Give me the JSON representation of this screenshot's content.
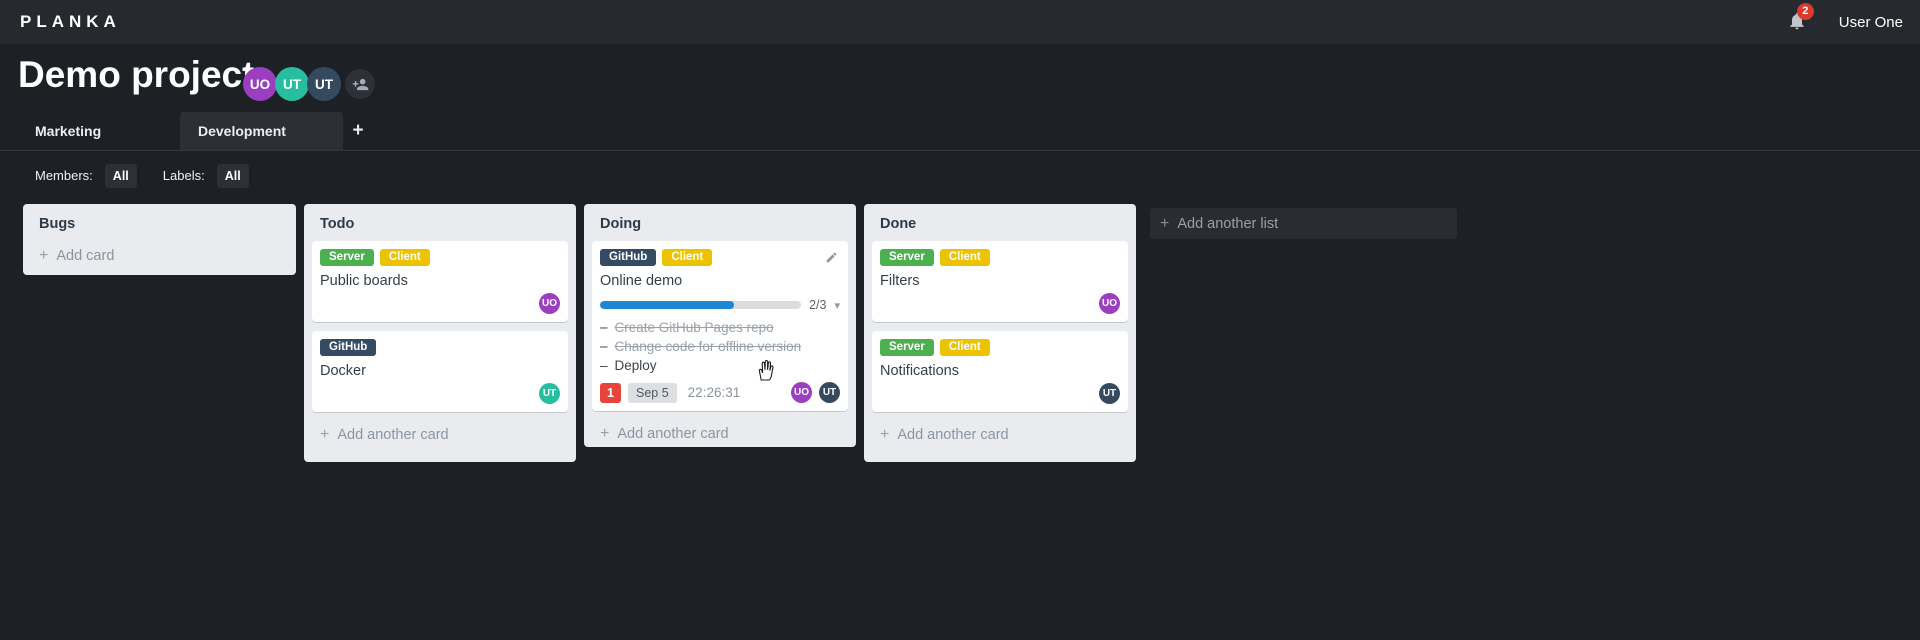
{
  "topbar": {
    "logo": "PLANKA",
    "user_name": "User One",
    "notifications_count": "2"
  },
  "project": {
    "title": "Demo project",
    "members": [
      {
        "initials": "UO",
        "color": "#9b3fc0"
      },
      {
        "initials": "UT",
        "color": "#28bd9e"
      },
      {
        "initials": "UT",
        "color": "#35495f"
      }
    ]
  },
  "tabs": {
    "items": [
      {
        "label": "Marketing"
      },
      {
        "label": "Development"
      }
    ],
    "add": "+"
  },
  "filters": {
    "members_label": "Members:",
    "members_value": "All",
    "labels_label": "Labels:",
    "labels_value": "All"
  },
  "icons": {
    "plus": "+",
    "caret_down": "▾"
  },
  "board": {
    "task_marker": "–",
    "add_list_label": "Add another list",
    "lists": [
      {
        "name": "Bugs",
        "add_label": "Add card",
        "cards": []
      },
      {
        "name": "Todo",
        "add_label": "Add another card",
        "cards": [
          {
            "title": "Public boards",
            "labels": [
              {
                "text": "Server",
                "color": "#4caf50"
              },
              {
                "text": "Client",
                "color": "#edc300"
              }
            ],
            "assignees": [
              {
                "initials": "UO",
                "color": "#9b3fc0"
              }
            ]
          },
          {
            "title": "Docker",
            "labels": [
              {
                "text": "GitHub",
                "color": "#354a63"
              }
            ],
            "assignees": [
              {
                "initials": "UT",
                "color": "#28bd9e"
              }
            ]
          }
        ]
      },
      {
        "name": "Doing",
        "add_label": "Add another card",
        "cards": [
          {
            "title": "Online demo",
            "labels": [
              {
                "text": "GitHub",
                "color": "#354a63"
              },
              {
                "text": "Client",
                "color": "#edc300"
              }
            ],
            "checklist": {
              "summary": "2/3",
              "done": 2,
              "total": 3,
              "pct_css": "66.7%",
              "tasks": [
                {
                  "text": "Create GitHub Pages repo",
                  "done": true
                },
                {
                  "text": "Change code for offline version",
                  "done": true
                },
                {
                  "text": "Deploy",
                  "done": false
                }
              ]
            },
            "badges": {
              "notifications": "1",
              "due_date": "Sep 5",
              "timer": "22:26:31"
            },
            "assignees": [
              {
                "initials": "UO",
                "color": "#9b3fc0"
              },
              {
                "initials": "UT",
                "color": "#35495f"
              }
            ]
          }
        ]
      },
      {
        "name": "Done",
        "add_label": "Add another card",
        "cards": [
          {
            "title": "Filters",
            "labels": [
              {
                "text": "Server",
                "color": "#4caf50"
              },
              {
                "text": "Client",
                "color": "#edc300"
              }
            ],
            "assignees": [
              {
                "initials": "UO",
                "color": "#9b3fc0"
              }
            ]
          },
          {
            "title": "Notifications",
            "labels": [
              {
                "text": "Server",
                "color": "#4caf50"
              },
              {
                "text": "Client",
                "color": "#edc300"
              }
            ],
            "assignees": [
              {
                "initials": "UT",
                "color": "#35495f"
              }
            ]
          }
        ]
      }
    ]
  }
}
